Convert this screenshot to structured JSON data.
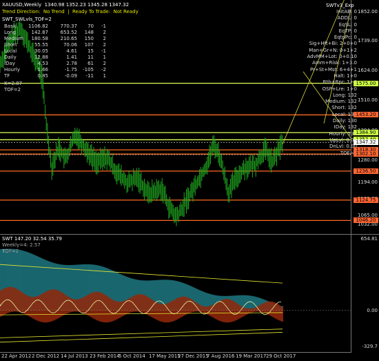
{
  "main_header": {
    "symbol_line": "XAUUSD,Weekly  1340.98 1352.23 1345.28 1347.32",
    "status_line": "Trend Direction:  No Trend  |  Ready To Trade:  Not Ready",
    "indicator_label": "SWT_SWLvls_TOF=2",
    "right_label": "SWTv3_Exp"
  },
  "stats_table": [
    [
      "Basic",
      "1106.82",
      "770.37",
      "70",
      "-1"
    ],
    [
      "Long",
      "142.87",
      "653.52",
      "148",
      "2"
    ],
    [
      "Medium",
      "180.58",
      "210.65",
      "150",
      "2"
    ],
    [
      "Short",
      "55.55",
      "70.06",
      "107",
      "2"
    ],
    [
      "Local",
      "30.05",
      "4.61",
      "15",
      "-1"
    ],
    [
      "Daily",
      "12.88",
      "1.41",
      "11",
      "1"
    ],
    [
      "IDay",
      "4.53",
      "2.78",
      "61",
      "2"
    ],
    [
      "Hourly",
      "1.66",
      "-1.75",
      "-105",
      "-2"
    ],
    [
      "TF",
      "0.85",
      "-0.09",
      "-11",
      "1"
    ]
  ],
  "extra_lines": [
    "K=2.87",
    "TOF=2"
  ],
  "right_panel": [
    [
      "InitAB:",
      "0"
    ],
    [
      "ADDL:",
      "0"
    ],
    [
      "EqSL:",
      "0"
    ],
    [
      "EqTP:",
      "0"
    ],
    [
      "EqtpPc:",
      "0"
    ],
    [
      "Sig+Hft+Bi:",
      "2+0+0"
    ],
    [
      "Man+Gr+N:",
      "0+1+2"
    ],
    [
      "AdvMM+Lot:",
      "0+0.10"
    ],
    [
      "Amm+Risk:",
      "1+3.0"
    ],
    [
      "Pr+St+Mst:",
      "6+4+1"
    ],
    [
      "Halt:",
      "1+0"
    ],
    [
      "Rtb+Rpr:",
      "1+0"
    ],
    [
      "OSP+Lre:",
      "1+0"
    ],
    [
      "Long:",
      "132"
    ],
    [
      "Medium:",
      "132"
    ],
    [
      "Short:",
      "132"
    ],
    [
      "Local:",
      "131"
    ],
    [
      "Daily:",
      "130"
    ],
    [
      "IDay:",
      "132"
    ],
    [
      "Hourly:",
      "132"
    ],
    [
      "UpLvl:",
      "0.00"
    ],
    [
      "DnLvl:",
      "0.00"
    ],
    [
      "TOF=2",
      ""
    ]
  ],
  "price_axis": {
    "ticks": [
      "1852.00",
      "1739.00",
      "1624.00",
      "1510.00",
      "1394.00",
      "1280.00",
      "1194.00",
      "1129.00",
      "1065.00",
      "1032.00"
    ],
    "tags": [
      {
        "value": "1575.00",
        "color": "#ccff44"
      },
      {
        "value": "1453.20",
        "color": "#ff6633"
      },
      {
        "value": "1384.90",
        "color": "#ccff44"
      },
      {
        "value": "1357.40",
        "color": "#ccff44"
      },
      {
        "value": "1347.32",
        "color": "#ffffff"
      },
      {
        "value": "1318.30",
        "color": "#ff6633"
      },
      {
        "value": "1302.10",
        "color": "#ff6633"
      },
      {
        "value": "1236.50",
        "color": "#ff6633"
      },
      {
        "value": "1124.75",
        "color": "#ff6633"
      },
      {
        "value": "1046.20",
        "color": "#ff6633"
      }
    ]
  },
  "sub_header": {
    "title": "SWT 147.20 32.54 35.79",
    "line2": "Weekly=4: 2.57",
    "line3": "TOF=2"
  },
  "sub_axis": {
    "ticks": [
      "654.81",
      "0.00",
      "-329.7"
    ]
  },
  "time_axis": [
    "22 Apr 2012",
    "2 Dec 2012",
    "14 Jul 2013",
    "23 Feb 2014",
    "5 Oct 2014",
    "17 May 2015",
    "27 Dec 2015",
    "7 Aug 2016",
    "19 Mar 2017",
    "29 Oct 2017"
  ],
  "colors": {
    "candle": "#1faa1f",
    "level_red": "#ff6a20",
    "level_yellow": "#ddff55",
    "histogram": "#2aa9b8",
    "band_red": "#d23a10",
    "band_yellow": "#e8e830"
  }
}
